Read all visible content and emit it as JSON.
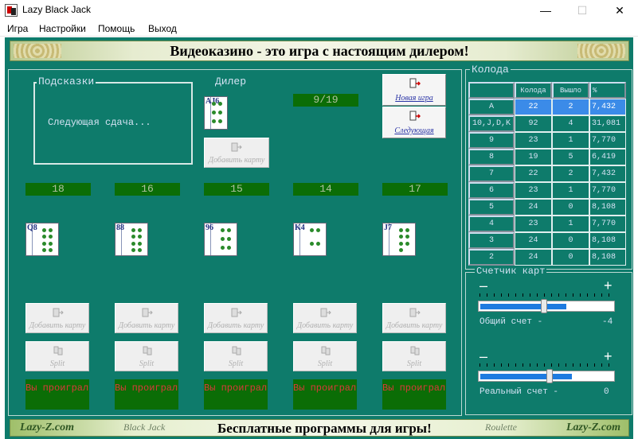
{
  "window": {
    "title": "Lazy Black Jack"
  },
  "menu": [
    "Игра",
    "Настройки",
    "Помощь",
    "Выход"
  ],
  "banner_top": "Видеоказино - это игра с настоящим дилером!",
  "banner_bottom": {
    "left": "Lazy-Z.com",
    "blackjack": "Black Jack",
    "center": "Бесплатные программы для игры!",
    "roulette": "Roulette",
    "right": "Lazy-Z.com"
  },
  "hints": {
    "label": "Подсказки",
    "text": "Следующая сдача..."
  },
  "dealer": {
    "label": "Дилер",
    "counter": "9/19",
    "card": "AJ6",
    "add_card": "Добавить карту"
  },
  "buttons": {
    "new_game": "Новая игра",
    "next": "Следующая"
  },
  "hands": [
    {
      "score": "18",
      "card": "Q8",
      "add_card": "Добавить карту",
      "split": "Split",
      "result": "Вы проиграли"
    },
    {
      "score": "16",
      "card": "88",
      "add_card": "Добавить карту",
      "split": "Split",
      "result": "Вы проиграли"
    },
    {
      "score": "15",
      "card": "96",
      "add_card": "Добавить карту",
      "split": "Split",
      "result": "Вы проиграли"
    },
    {
      "score": "14",
      "card": "K4",
      "add_card": "Добавить карту",
      "split": "Split",
      "result": "Вы проиграли"
    },
    {
      "score": "17",
      "card": "J7",
      "add_card": "Добавить карту",
      "split": "Split",
      "result": "Вы проиграли"
    }
  ],
  "deck": {
    "label": "Колода",
    "headers": [
      "",
      "Колода",
      "Вышло",
      "%"
    ],
    "rows": [
      [
        "A",
        "22",
        "2",
        "7,432"
      ],
      [
        "10,J,D,K",
        "92",
        "4",
        "31,081"
      ],
      [
        "9",
        "23",
        "1",
        "7,770"
      ],
      [
        "8",
        "19",
        "5",
        "6,419"
      ],
      [
        "7",
        "22",
        "2",
        "7,432"
      ],
      [
        "6",
        "23",
        "1",
        "7,770"
      ],
      [
        "5",
        "24",
        "0",
        "8,108"
      ],
      [
        "4",
        "23",
        "1",
        "7,770"
      ],
      [
        "3",
        "24",
        "0",
        "8,108"
      ],
      [
        "2",
        "24",
        "0",
        "8,108"
      ]
    ]
  },
  "counter": {
    "label": "Счетчик карт",
    "minus": "–",
    "plus": "+",
    "total_label": "Общий счет -",
    "total_value": "-4",
    "total_level": 0.46,
    "real_label": "Реальный счет -",
    "real_value": "0",
    "real_level": 0.5
  },
  "colors": {
    "felt": "#0e7b6b",
    "green_box": "#0b6d06",
    "lose_text": "#d83a3a",
    "selected": "#3b8be8"
  }
}
